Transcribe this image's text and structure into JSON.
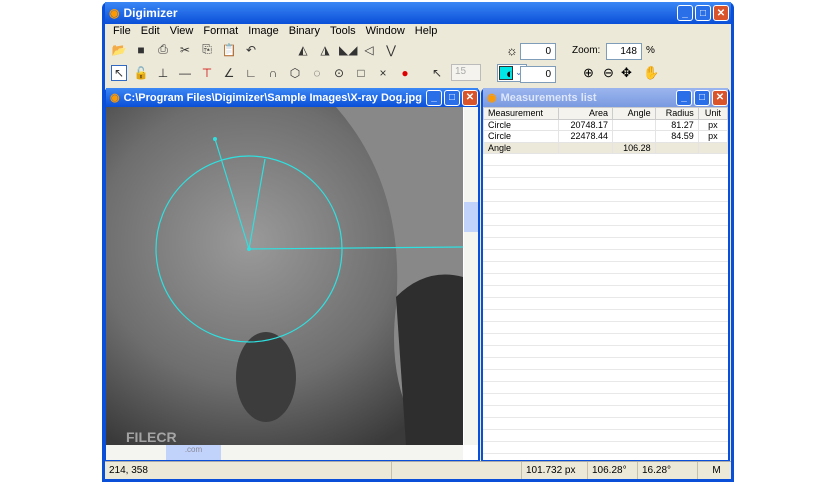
{
  "app": {
    "title": "Digimizer"
  },
  "menu": [
    "File",
    "Edit",
    "View",
    "Format",
    "Image",
    "Binary",
    "Tools",
    "Window",
    "Help"
  ],
  "toolbar": {
    "brightness": "0",
    "contrast": "0",
    "zoom_label": "Zoom:",
    "zoom": "148",
    "zoom_unit": "%",
    "line_width": "15",
    "color": "#00e5e5"
  },
  "image_window": {
    "title": "C:\\Program Files\\Digimizer\\Sample Images\\X-ray Dog.jpg",
    "watermark": "FILECR",
    "watermark_sub": ".com"
  },
  "measurements": {
    "title": "Measurements list",
    "columns": [
      "Measurement",
      "Area",
      "Angle",
      "Radius",
      "Unit"
    ],
    "rows": [
      [
        "Circle",
        "20748.17",
        "",
        "81.27",
        "px"
      ],
      [
        "Circle",
        "22478.44",
        "",
        "84.59",
        "px"
      ],
      [
        "Angle",
        "",
        "106.28",
        "",
        ""
      ]
    ]
  },
  "status": {
    "coords": "214, 358",
    "length": "101.732 px",
    "angle1": "106.28°",
    "angle2": "16.28°",
    "mode": "M"
  }
}
